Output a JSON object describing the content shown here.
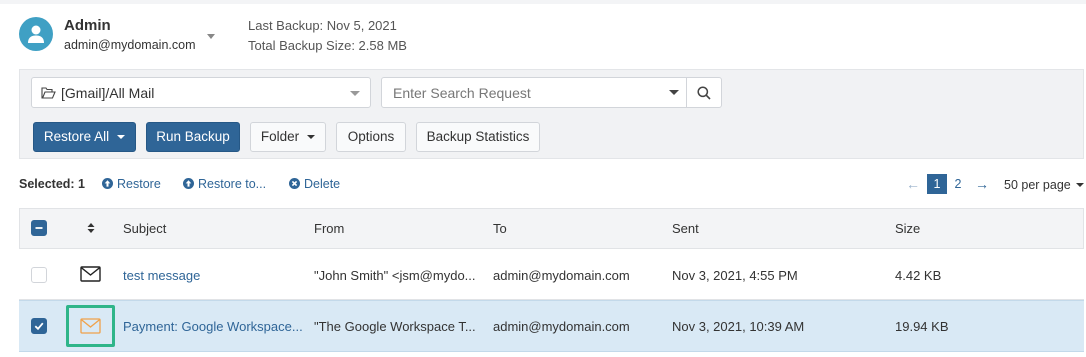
{
  "header": {
    "user_name": "Admin",
    "user_email": "admin@mydomain.com",
    "last_backup": "Last Backup: Nov 5, 2021",
    "total_backup_size": "Total Backup Size: 2.58 MB",
    "avatar_icon": "user-icon",
    "avatar_color": "#3fa0c4"
  },
  "toolbar": {
    "folder_value": "[Gmail]/All Mail",
    "folder_icon": "folder-open-icon",
    "search_placeholder": "Enter Search Request",
    "search_icon": "search-icon",
    "restore_all_label": "Restore All",
    "run_backup_label": "Run Backup",
    "folder_label": "Folder",
    "options_label": "Options",
    "backup_statistics_label": "Backup Statistics",
    "primary_color": "#2f6597"
  },
  "selection_bar": {
    "selected_label": "Selected: 1",
    "restore_label": "Restore",
    "restore_to_label": "Restore to...",
    "delete_label": "Delete"
  },
  "pagination": {
    "prev_glyph": "←",
    "next_glyph": "→",
    "pages": [
      "1",
      "2"
    ],
    "current_page": "1",
    "per_page_label": "50 per page"
  },
  "table": {
    "columns": [
      "Subject",
      "From",
      "To",
      "Sent",
      "Size"
    ],
    "rows": [
      {
        "selected": false,
        "subject": "test message",
        "from": "\"John Smith\" <jsm@mydo...",
        "to": "admin@mydomain.com",
        "sent": "Nov 3, 2021, 4:55 PM",
        "size": "4.42 KB"
      },
      {
        "selected": true,
        "subject": "Payment: Google Workspace...",
        "from": "\"The Google Workspace T...",
        "to": "admin@mydomain.com",
        "sent": "Nov 3, 2021, 10:39 AM",
        "size": "19.94 KB"
      }
    ],
    "highlight_color": "#2fb589",
    "selected_row_color": "#d9e9f5"
  }
}
